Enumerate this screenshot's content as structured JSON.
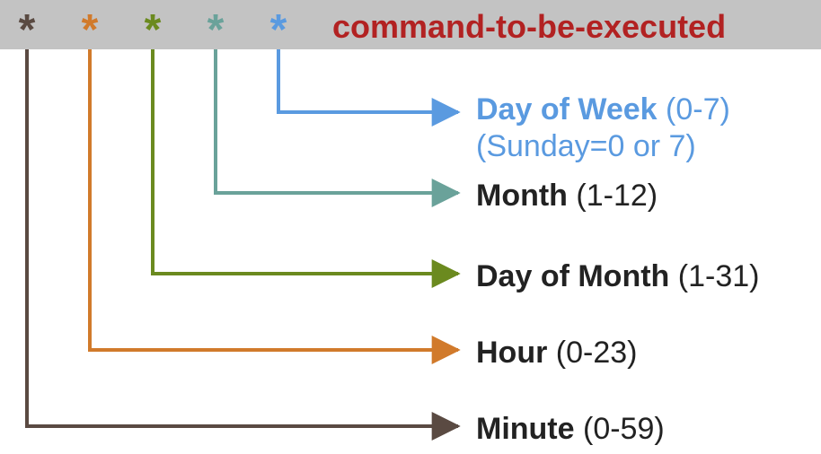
{
  "colors": {
    "minute": "#5a4a42",
    "hour": "#d17a2b",
    "dom": "#6b8a1f",
    "month": "#6aa29a",
    "dow": "#5a9ae0",
    "command": "#b22222",
    "header_bg": "#c3c3c3",
    "text": "#222222"
  },
  "header": {
    "stars": [
      {
        "key": "minute",
        "glyph": "*"
      },
      {
        "key": "hour",
        "glyph": "*"
      },
      {
        "key": "dom",
        "glyph": "*"
      },
      {
        "key": "month",
        "glyph": "*"
      },
      {
        "key": "dow",
        "glyph": "*"
      }
    ],
    "command": "command-to-be-executed"
  },
  "fields": {
    "dow": {
      "label": "Day of Week",
      "range": "(0-7)",
      "note": "(Sunday=0 or 7)"
    },
    "month": {
      "label": "Month",
      "range": "(1-12)"
    },
    "dom": {
      "label": "Day of Month",
      "range": "(1-31)"
    },
    "hour": {
      "label": "Hour",
      "range": "(0-23)"
    },
    "minute": {
      "label": "Minute",
      "range": "(0-59)"
    }
  }
}
